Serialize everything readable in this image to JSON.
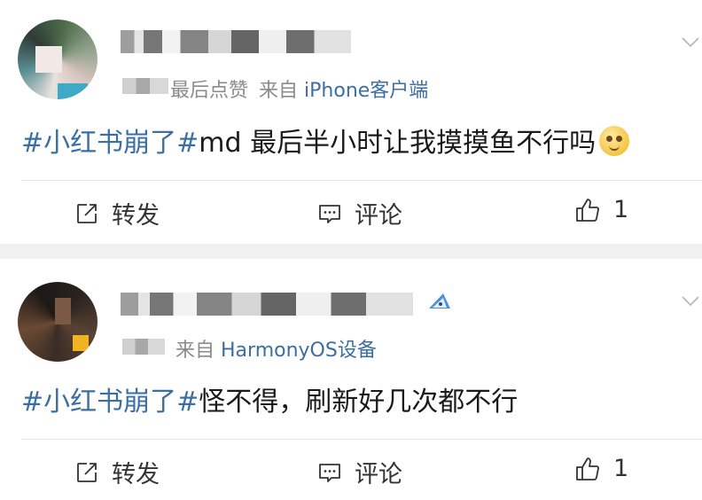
{
  "posts": [
    {
      "meta_suffix": "最后点赞",
      "source_prefix": "来自",
      "source_client": "iPhone客户端",
      "hashtag": "#小红书崩了#",
      "text": "md 最后半小时让我摸摸鱼不行吗",
      "actions": {
        "repost": "转发",
        "comment": "评论",
        "likes": "1"
      }
    },
    {
      "source_prefix": "来自",
      "source_client": "HarmonyOS设备",
      "hashtag": "#小红书崩了#",
      "text": "怪不得，刷新好几次都不行",
      "actions": {
        "repost": "转发",
        "comment": "评论",
        "likes": "1"
      }
    }
  ],
  "icons": {
    "expand": "chevron-down-icon",
    "repost": "repost-icon",
    "comment": "comment-icon",
    "like": "thumbs-up-icon",
    "emoji": "drooling-face-emoji"
  },
  "colors": {
    "link": "#3b6fa3",
    "meta": "#8a8a8a",
    "divider": "#f1f1f1"
  }
}
